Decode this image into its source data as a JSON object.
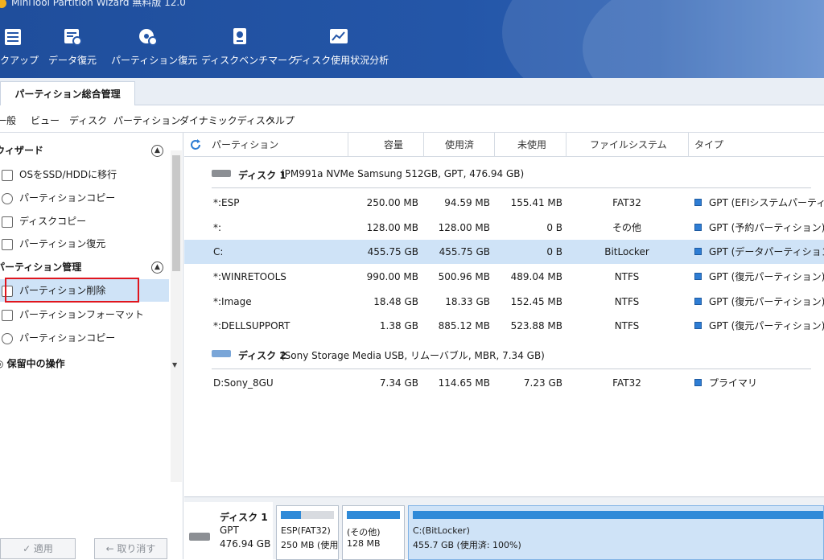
{
  "app": {
    "title": "MiniTool Partition Wizard 無料版 12.0"
  },
  "toolbar": [
    {
      "label": "ックアップ",
      "icon": "backup-icon"
    },
    {
      "label": "データ復元",
      "icon": "data-recovery-icon"
    },
    {
      "label": "パーティション復元",
      "icon": "partition-recovery-icon"
    },
    {
      "label": "ディスクベンチマーク",
      "icon": "disk-benchmark-icon"
    },
    {
      "label": "ディスク使用状況分析",
      "icon": "space-analyzer-icon"
    }
  ],
  "tab": {
    "label": "パーティション総合管理"
  },
  "menu": [
    "一般",
    "ビュー",
    "ディスク",
    "パーティション",
    "ダイナミックディスク",
    "ヘルプ"
  ],
  "left_panel": {
    "wizard": {
      "title": "ウィザード",
      "items": [
        "OSをSSD/HDDに移行",
        "パーティションコピー",
        "ディスクコピー",
        "パーティション復元"
      ]
    },
    "partition_mgmt": {
      "title": "パーティション管理",
      "items": [
        "パーティション削除",
        "パーティションフォーマット",
        "パーティションコピー"
      ]
    },
    "pending": {
      "title": "保留中の操作"
    },
    "apply_label": "✓ 適用",
    "undo_label": "← 取り消す"
  },
  "grid": {
    "headers": [
      "パーティション",
      "容量",
      "使用済",
      "未使用",
      "ファイルシステム",
      "タイプ"
    ],
    "disks": [
      {
        "name": "ディスク 1",
        "desc": "(PM991a NVMe Samsung 512GB, GPT, 476.94 GB)",
        "partitions": [
          {
            "name": "*:ESP",
            "capacity": "250.00 MB",
            "used": "94.59 MB",
            "unused": "155.41 MB",
            "fs": "FAT32",
            "type": "GPT (EFIシステムパーティション)"
          },
          {
            "name": "*:",
            "capacity": "128.00 MB",
            "used": "128.00 MB",
            "unused": "0 B",
            "fs": "その他",
            "type": "GPT (予約パーティション)"
          },
          {
            "name": "C:",
            "capacity": "455.75 GB",
            "used": "455.75 GB",
            "unused": "0 B",
            "fs": "BitLocker",
            "type": "GPT (データパーティション)"
          },
          {
            "name": "*:WINRETOOLS",
            "capacity": "990.00 MB",
            "used": "500.96 MB",
            "unused": "489.04 MB",
            "fs": "NTFS",
            "type": "GPT (復元パーティション)"
          },
          {
            "name": "*:Image",
            "capacity": "18.48 GB",
            "used": "18.33 GB",
            "unused": "152.45 MB",
            "fs": "NTFS",
            "type": "GPT (復元パーティション)"
          },
          {
            "name": "*:DELLSUPPORT",
            "capacity": "1.38 GB",
            "used": "885.12 MB",
            "unused": "523.88 MB",
            "fs": "NTFS",
            "type": "GPT (復元パーティション)"
          }
        ]
      },
      {
        "name": "ディスク 2",
        "desc": "(Sony Storage Media USB, リムーバブル, MBR, 7.34 GB)",
        "partitions": [
          {
            "name": "D:Sony_8GU",
            "capacity": "7.34 GB",
            "used": "114.65 MB",
            "unused": "7.23 GB",
            "fs": "FAT32",
            "type": "プライマリ"
          }
        ]
      }
    ]
  },
  "disk_map": {
    "disk": {
      "name": "ディスク 1",
      "scheme": "GPT",
      "size": "476.94 GB"
    },
    "parts": [
      {
        "label": "ESP(FAT32)",
        "info": "250 MB (使用",
        "used_fraction": 0.38
      },
      {
        "label": "(その他)",
        "info": "128 MB",
        "used_fraction": 1.0
      },
      {
        "label": "C:(BitLocker)",
        "info": "455.7 GB (使用済: 100%)",
        "used_fraction": 1.0
      }
    ]
  },
  "colors": {
    "banner": "#2456a8",
    "selection": "#cfe3f7",
    "highlight_box": "#e0161e",
    "type_square": "#2e7dd4"
  }
}
